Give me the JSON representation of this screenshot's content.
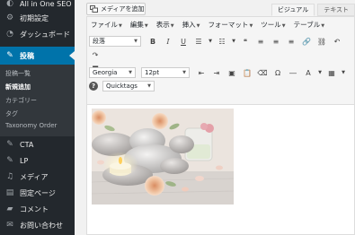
{
  "sidebar": {
    "items": [
      {
        "label": "All in One SEO",
        "icon": "seo-icon"
      },
      {
        "label": "初期設定",
        "icon": "gear-icon"
      },
      {
        "label": "ダッシュボード",
        "icon": "dashboard-icon"
      },
      {
        "label": "投稿",
        "icon": "pin-icon",
        "active": true
      },
      {
        "label": "CTA",
        "icon": "pin-icon"
      },
      {
        "label": "LP",
        "icon": "pin-icon"
      },
      {
        "label": "メディア",
        "icon": "media-icon"
      },
      {
        "label": "固定ページ",
        "icon": "page-icon"
      },
      {
        "label": "コメント",
        "icon": "comment-icon"
      },
      {
        "label": "お問い合わせ",
        "icon": "mail-icon"
      }
    ],
    "submenu": [
      {
        "label": "投稿一覧"
      },
      {
        "label": "新規追加",
        "current": true
      },
      {
        "label": "カテゴリー"
      },
      {
        "label": "タグ"
      },
      {
        "label": "Taxonomy Order"
      }
    ]
  },
  "editor": {
    "add_media_label": "メディアを追加",
    "tabs": {
      "visual": "ビジュアル",
      "text": "テキスト"
    },
    "menubar": [
      "ファイル",
      "編集",
      "表示",
      "挿入",
      "フォーマット",
      "ツール",
      "テーブル"
    ],
    "format_select": "段落",
    "font_family_select": "Georgia",
    "font_size_select": "12pt",
    "quicktags_select": "Quicktags",
    "bold_label": "B",
    "italic_label": "I",
    "underline_label": "U",
    "help_label": "?",
    "content_image": "spa-stones-candles-roses-photo"
  }
}
